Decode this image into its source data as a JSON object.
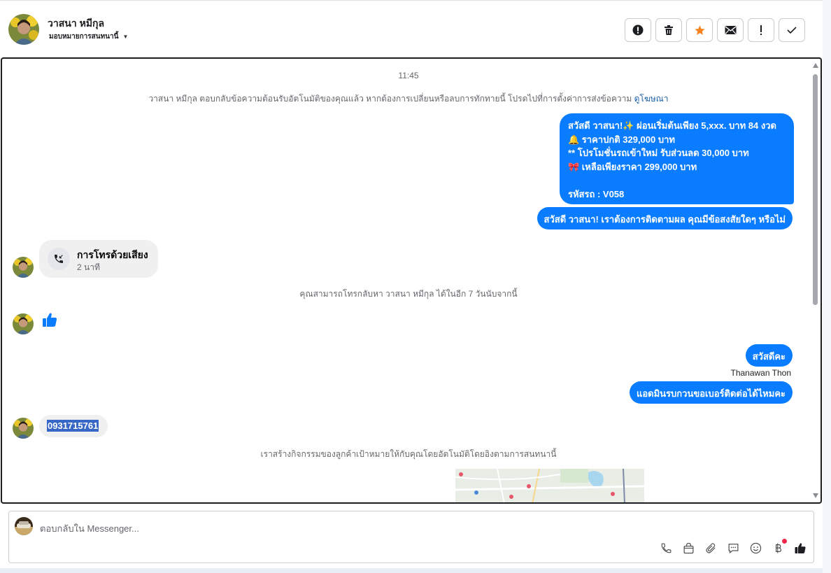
{
  "header": {
    "contact_name": "วาสนา หมีกุล",
    "assign_label": "มอบหมายการสนทนานี้",
    "actions": [
      {
        "name": "spam-button",
        "icon": "alert-circle-icon"
      },
      {
        "name": "delete-button",
        "icon": "trash-icon"
      },
      {
        "name": "star-button",
        "icon": "star-icon"
      },
      {
        "name": "mark-unread-button",
        "icon": "envelope-icon"
      },
      {
        "name": "follow-up-button",
        "icon": "exclamation-icon"
      },
      {
        "name": "done-button",
        "icon": "check-icon"
      }
    ]
  },
  "chat": {
    "timestamp": "11:45",
    "auto_reply_notice": "วาสนา หมีกุล ตอบกลับข้อความต้อนรับอัตโนมัติของคุณแล้ว หากต้องการเปลี่ยนหรือลบการทักทายนี้ โปรดไปที่การตั้งค่าการส่งข้อความ",
    "auto_reply_link": "ดูโฆษณา",
    "promo_lines": [
      "สวัสดี วาสนา!✨  ผ่อนเริ่มต้นเพียง 5,xxx. บาท 84 งวด",
      "🔔 ราคาปกติ 329,000 บาท",
      "** โปรโมชั่นรถเข้าใหม่ รับส่วนลด 30,000 บาท",
      "🎀  เหลือเพียงราคา 299,000 บาท",
      "",
      " รหัสรถ : V058"
    ],
    "followup_message": "สวัสดี วาสนา! เราต้องการติดตามผล คุณมีข้อสงสัยใดๆ หรือไม่",
    "call_title": "การโทรด้วยเสียง",
    "call_duration": "2 นาที",
    "callback_notice": "คุณสามารถโทรกลับหา วาสนา หมีกุล ได้ในอีก 7 วันนับจากนี้",
    "hi_message": "สวัสดีคะ",
    "sender_name": "Thanawan Thon",
    "admin_message": "แอดมินรบกวนขอเบอร์ติดต่อได้ไหมคะ",
    "phone_number": "0931715761",
    "activity_notice": "เราสร้างกิจกรรมของลูกค้าเป้าหมายให้กับคุณโดยอัตโนมัติโดยอิงตามการสนทนานี้"
  },
  "composer": {
    "placeholder": "ตอบกลับใน Messenger...",
    "tools": [
      "phone-icon",
      "shopping-bag-icon",
      "paperclip-icon",
      "saved-reply-icon",
      "emoji-icon",
      "baht-icon",
      "thumbs-up-icon"
    ]
  },
  "colors": {
    "outgoing": "#0a7cff",
    "incoming": "#f0f0f0",
    "star": "#f5821f",
    "link": "#1a5fa8"
  }
}
